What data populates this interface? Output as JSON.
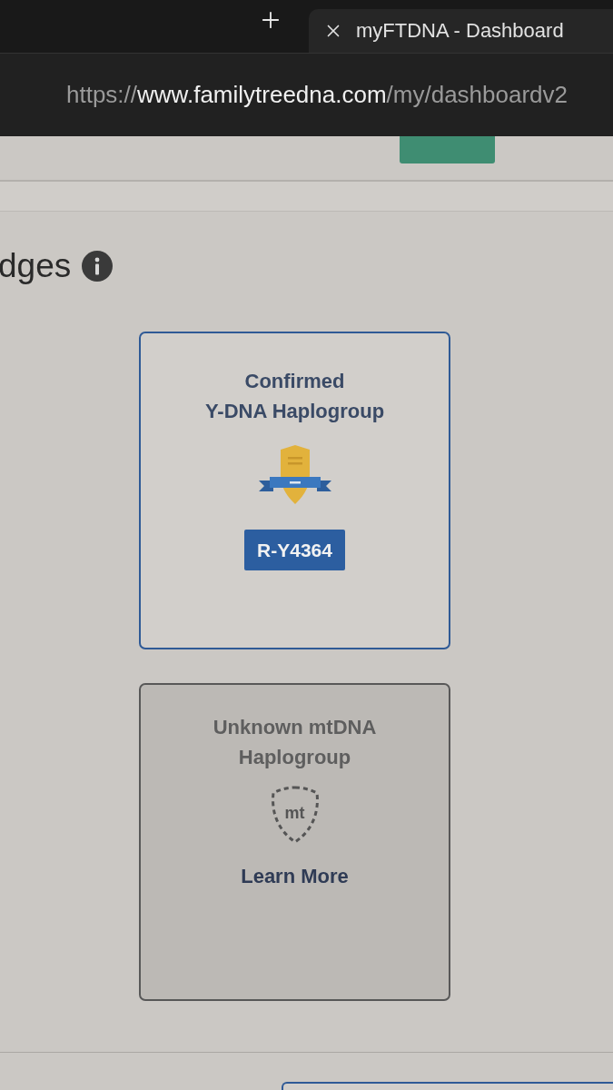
{
  "browser": {
    "tab": {
      "title": "myFTDNA - Dashboard"
    },
    "address": {
      "scheme": "https://",
      "domain": "www.familytreedna.com",
      "path": "/my/dashboardv2"
    }
  },
  "heading": {
    "text": "dges"
  },
  "badges": [
    {
      "kind": "earned",
      "title": "Confirmed\nY-DNA Haplogroup",
      "value": "R-Y4364"
    },
    {
      "kind": "unknown",
      "title": "Unknown mtDNA\nHaplogroup",
      "icon_text": "mt",
      "link": "Learn More"
    }
  ]
}
